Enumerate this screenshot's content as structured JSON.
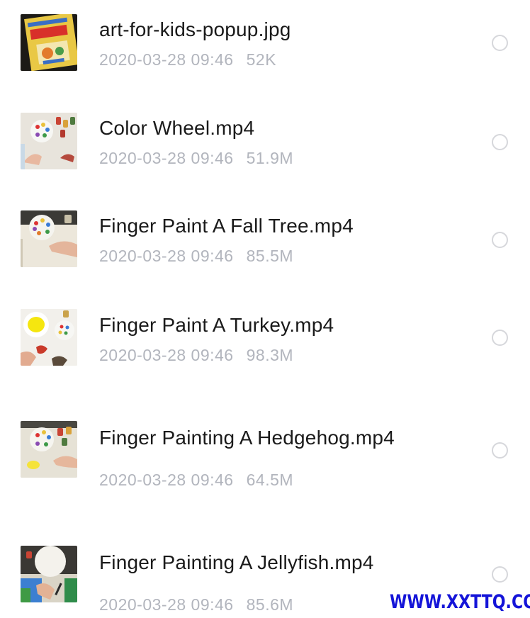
{
  "files": [
    {
      "name": "art-for-kids-popup.jpg",
      "date": "2020-03-28 09:46",
      "size": "52K",
      "thumbnail": "popup-book-cover-thumbnail"
    },
    {
      "name": "Color Wheel.mp4",
      "date": "2020-03-28 09:46",
      "size": "51.9M",
      "thumbnail": "paint-palette-hands-thumbnail"
    },
    {
      "name": "Finger Paint A Fall Tree.mp4",
      "date": "2020-03-28 09:46",
      "size": "85.5M",
      "thumbnail": "paint-palette-hand-thumbnail"
    },
    {
      "name": "Finger Paint A Turkey.mp4",
      "date": "2020-03-28 09:46",
      "size": "98.3M",
      "thumbnail": "yellow-paint-turkey-thumbnail"
    },
    {
      "name": "Finger Painting A Hedgehog.mp4",
      "date": "2020-03-28 09:46",
      "size": "64.5M",
      "thumbnail": "paint-palette-hedgehog-thumbnail"
    },
    {
      "name": "Finger Painting A Jellyfish.mp4",
      "date": "2020-03-28 09:46",
      "size": "85.6M",
      "thumbnail": "white-plate-jellyfish-thumbnail"
    }
  ],
  "watermark": "WWW.XXTTQ.COM",
  "colors": {
    "name_text": "#1a1a1a",
    "meta_text": "#b2b5bd",
    "radio_border": "#d6d7db",
    "watermark": "#1414d8"
  }
}
